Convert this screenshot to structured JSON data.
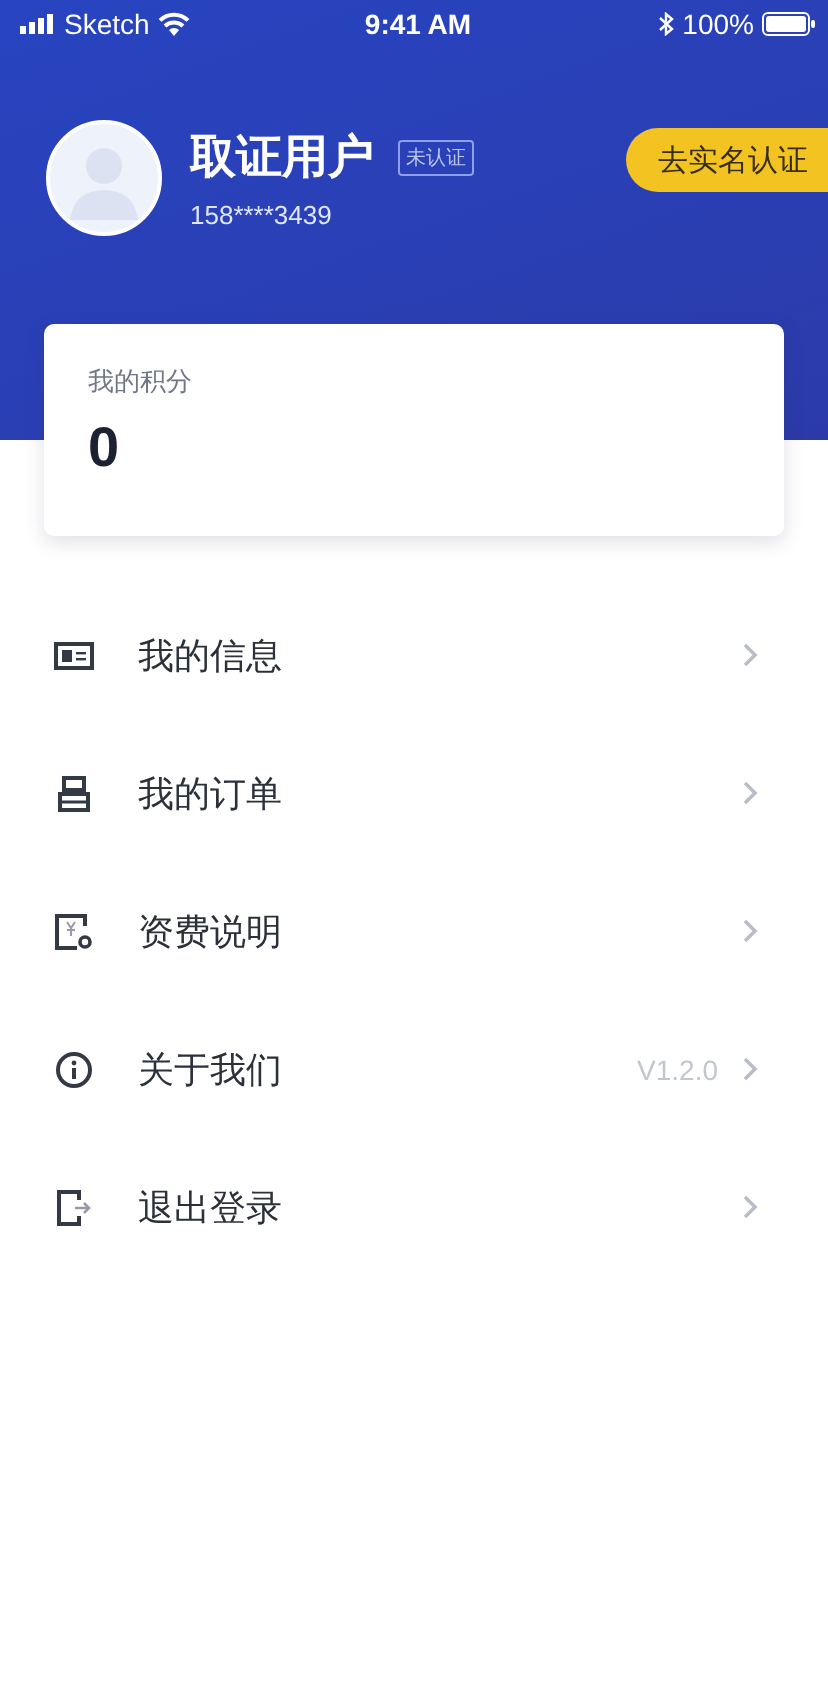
{
  "status_bar": {
    "carrier": "Sketch",
    "time": "9:41 AM",
    "battery": "100%"
  },
  "profile": {
    "name": "取证用户",
    "badge": "未认证",
    "phone": "158****3439",
    "verify_button": "去实名认证"
  },
  "points_card": {
    "label": "我的积分",
    "value": "0"
  },
  "menu": [
    {
      "kind": "card",
      "label": "我的信息"
    },
    {
      "kind": "order",
      "label": "我的订单"
    },
    {
      "kind": "fee",
      "label": "资费说明"
    },
    {
      "kind": "info",
      "label": "关于我们",
      "value": "V1.2.0"
    },
    {
      "kind": "logout",
      "label": "退出登录"
    }
  ]
}
